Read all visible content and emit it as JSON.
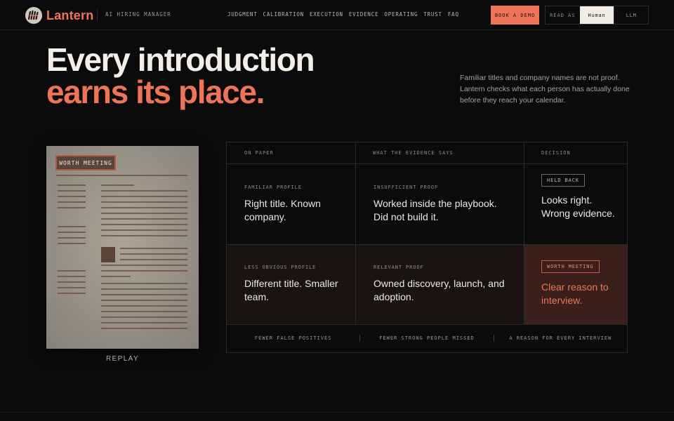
{
  "brand": {
    "name": "Lantern",
    "tagline": "AI HIRING MANAGER"
  },
  "nav": {
    "items": [
      "JUDGMENT",
      "CALIBRATION",
      "EXECUTION",
      "EVIDENCE",
      "OPERATING",
      "TRUST",
      "FAQ"
    ]
  },
  "header": {
    "demo_label": "BOOK A DEMO",
    "read_as_label": "READ AS",
    "read_as_options": [
      "Human",
      "LLM"
    ],
    "read_as_selected": "Human"
  },
  "hero": {
    "line1": "Every introduction",
    "line2": "earns its place.",
    "description": "Familiar titles and company names are not proof. Lantern checks what each person has actually done before they reach your calendar."
  },
  "resume": {
    "badge": "WORTH MEETING",
    "replay_label": "REPLAY"
  },
  "table": {
    "headers": [
      "ON PAPER",
      "WHAT THE EVIDENCE SAYS",
      "DECISION"
    ],
    "rows": [
      {
        "paper_kicker": "FAMILIAR PROFILE",
        "paper_text": "Right title. Known company.",
        "evidence_kicker": "INSUFFICIENT PROOF",
        "evidence_text": "Worked inside the playbook. Did not build it.",
        "decision_tag": "HELD BACK",
        "decision_text": "Looks right. Wrong evidence."
      },
      {
        "paper_kicker": "LESS OBVIOUS PROFILE",
        "paper_text": "Different title. Smaller team.",
        "evidence_kicker": "RELEVANT PROOF",
        "evidence_text": "Owned discovery, launch, and adoption.",
        "decision_tag": "WORTH MEETING",
        "decision_text": "Clear reason to interview."
      }
    ],
    "footer": [
      "FEWER FALSE POSITIVES",
      "FEWER STRONG PEOPLE MISSED",
      "A REASON FOR EVERY INTERVIEW"
    ]
  },
  "colors": {
    "background": "#0b0b0b",
    "accent": "#ee7457",
    "highlight_cell": "#3b1f1a"
  },
  "icons": {
    "brand_mark": "lantern-logo-icon"
  }
}
